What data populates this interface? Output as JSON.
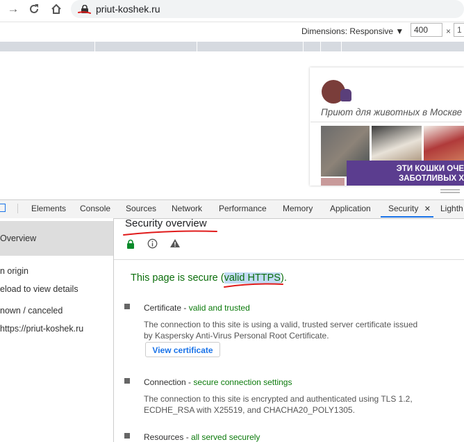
{
  "browser": {
    "url": "priut-koshek.ru",
    "nav_icons": [
      "forward-icon",
      "reload-icon",
      "home-icon"
    ]
  },
  "device_toolbar": {
    "dimensions_label": "Dimensions: Responsive ▼",
    "width_value": "400",
    "times": "×",
    "height_value": "1"
  },
  "site": {
    "tagline": "Приют для животных в Москве",
    "banner_line1": "ЭТИ КОШКИ ОЧЕ",
    "banner_line2": "ЗАБОТЛИВЫХ Х"
  },
  "devtools": {
    "tabs": [
      "Elements",
      "Console",
      "Sources",
      "Network",
      "Performance",
      "Memory",
      "Application",
      "Security",
      "Lighth"
    ],
    "active_tab": "Security",
    "close_glyph": "✕"
  },
  "sidebar": {
    "items": [
      "Overview",
      "n origin",
      "eload to view details",
      "nown / canceled",
      "https://priut-koshek.ru"
    ]
  },
  "security": {
    "title": "Security overview",
    "summary_prefix": "This page is secure (",
    "summary_link": "valid HTTPS",
    "summary_suffix": ").",
    "certificate": {
      "label": "Certificate",
      "dash": " - ",
      "status": "valid and trusted",
      "desc": "The connection to this site is using a valid, trusted server certificate issued by Kaspersky Anti-Virus Personal Root Certificate.",
      "button": "View certificate"
    },
    "connection": {
      "label": "Connection",
      "dash": " - ",
      "status": "secure connection settings",
      "desc": "The connection to this site is encrypted and authenticated using TLS 1.2, ECDHE_RSA with X25519, and CHACHA20_POLY1305."
    },
    "resources": {
      "label": "Resources",
      "dash": " - ",
      "status": "all served securely"
    }
  },
  "colors": {
    "secure_green": "#0b6e0b",
    "link_blue": "#1a73e8",
    "annotation_red": "#e01b1b"
  }
}
